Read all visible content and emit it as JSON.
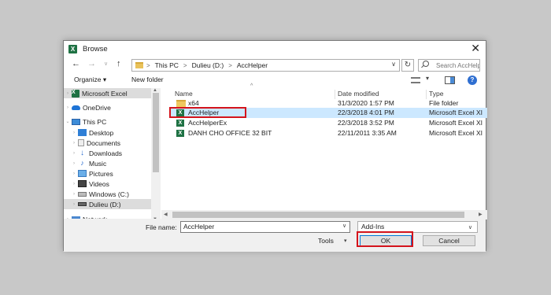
{
  "window": {
    "title": "Browse",
    "app_icon": "excel-icon"
  },
  "address": {
    "segments": [
      "This PC",
      "Dulieu (D:)",
      "AccHelper"
    ],
    "separator": ">"
  },
  "search": {
    "placeholder": "Search AccHelper"
  },
  "toolbar": {
    "organize_label": "Organize ▾",
    "new_folder_label": "New folder"
  },
  "sidebar": {
    "items": [
      {
        "label": "Microsoft Excel",
        "icon": "excel-icon"
      },
      {
        "label": "OneDrive",
        "icon": "cloud-icon"
      },
      {
        "label": "This PC",
        "icon": "computer-icon"
      },
      {
        "label": "Desktop",
        "icon": "desktop-icon"
      },
      {
        "label": "Documents",
        "icon": "documents-icon"
      },
      {
        "label": "Downloads",
        "icon": "downloads-icon"
      },
      {
        "label": "Music",
        "icon": "music-icon"
      },
      {
        "label": "Pictures",
        "icon": "pictures-icon"
      },
      {
        "label": "Videos",
        "icon": "videos-icon"
      },
      {
        "label": "Windows (C:)",
        "icon": "drive-icon"
      },
      {
        "label": "Dulieu (D:)",
        "icon": "drive-icon"
      },
      {
        "label": "Network",
        "icon": "network-icon"
      }
    ]
  },
  "columns": {
    "name": "Name",
    "date": "Date modified",
    "type": "Type"
  },
  "files": [
    {
      "name": "x64",
      "date": "31/3/2020 1:57 PM",
      "type": "File folder",
      "icon": "folder-icon"
    },
    {
      "name": "AccHelper",
      "date": "22/3/2018 4:01 PM",
      "type": "Microsoft Excel XI",
      "icon": "excel-file-icon"
    },
    {
      "name": "AccHelperEx",
      "date": "22/3/2018 3:52 PM",
      "type": "Microsoft Excel XI",
      "icon": "excel-file-icon"
    },
    {
      "name": "DANH CHO OFFICE 32 BIT",
      "date": "22/11/2011 3:35 AM",
      "type": "Microsoft Excel XI",
      "icon": "excel-file-icon"
    }
  ],
  "footer": {
    "file_name_label": "File name:",
    "file_name_value": "AccHelper",
    "file_type_value": "Add-Ins",
    "tools_label": "Tools",
    "ok_label": "OK",
    "cancel_label": "Cancel"
  },
  "colors": {
    "highlight": "#d4141c",
    "selection": "#cce8ff",
    "excel": "#1f7244"
  }
}
